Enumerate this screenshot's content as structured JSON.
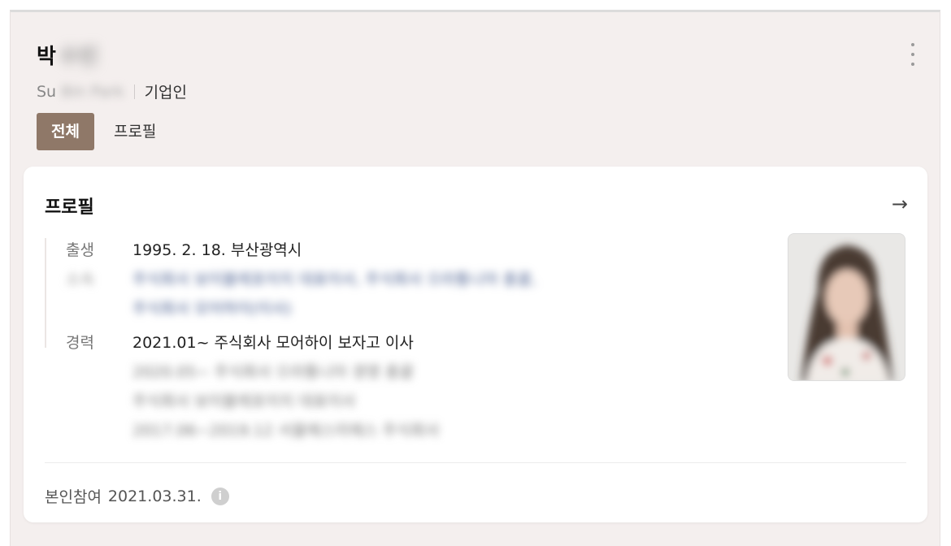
{
  "header": {
    "name_visible": "박",
    "name_blurred": "수빈",
    "english_name_visible": "Su",
    "english_name_blurred": "Bin Park",
    "role": "기업인",
    "more_icon": "kebab-vertical-icon"
  },
  "tabs": [
    {
      "label": "전체",
      "active": true
    },
    {
      "label": "프로필",
      "active": false
    }
  ],
  "profile": {
    "title": "프로필",
    "arrow_icon": "arrow-right-icon",
    "rows": {
      "birth": {
        "label": "출생",
        "value": "1995. 2. 18. 부산광역시"
      },
      "affiliation": {
        "label": "소속",
        "lines": [
          "주식회사 보이블레포이지 대표이사, 주식회사 으라통니아 총괄,",
          "주식회사 모어하이(이사)"
        ]
      },
      "career": {
        "label": "경력",
        "lines": [
          "2021.01~ 주식회사 모어하이 보자고 이사",
          "2020.05~ 주식회사 으라통니아 경영 총괄",
          "주식회사 보이블레포이지 대표이사",
          "2017.06~2019.12 서울에스미에스 주식회사"
        ]
      }
    },
    "photo_alt": "profile-photo"
  },
  "footer": {
    "label": "본인참여",
    "date": "2021.03.31.",
    "info_icon": "info-icon"
  },
  "colors": {
    "page_bg": "#f4efee",
    "active_tab": "#8f7868",
    "card_bg": "#ffffff"
  }
}
